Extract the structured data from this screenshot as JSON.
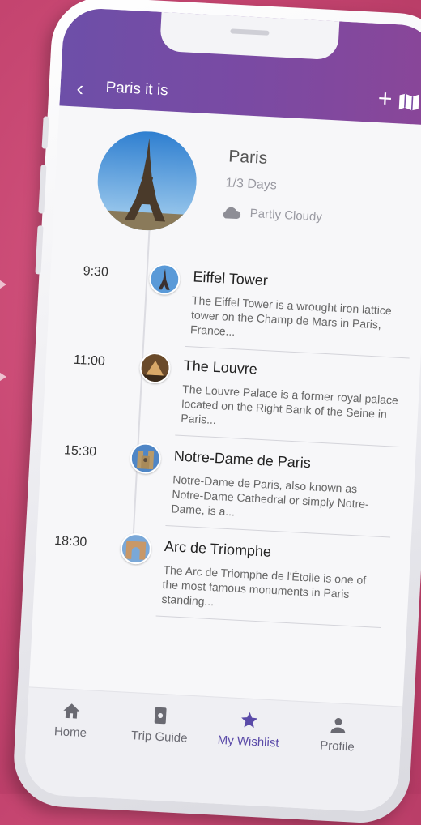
{
  "header": {
    "title": "Paris it is"
  },
  "city": {
    "name": "Paris",
    "days": "1/3 Days",
    "weather": "Partly Cloudy"
  },
  "stops": [
    {
      "time": "9:30",
      "name": "Eiffel Tower",
      "description": "The Eiffel Tower is a wrought iron lattice tower on the Champ de Mars in Paris, France..."
    },
    {
      "time": "11:00",
      "name": "The Louvre",
      "description": "The Louvre Palace is a former royal palace located on the Right Bank of the Seine in Paris..."
    },
    {
      "time": "15:30",
      "name": "Notre-Dame de Paris",
      "description": "Notre-Dame de Paris, also known as Notre-Dame Cathedral or simply Notre-Dame, is a..."
    },
    {
      "time": "18:30",
      "name": "Arc de Triomphe",
      "description": "The Arc de Triomphe de l'Étoile is one of the most famous monuments in Paris standing..."
    }
  ],
  "tabs": [
    {
      "label": "Home",
      "icon": "home-icon",
      "active": false
    },
    {
      "label": "Trip Guide",
      "icon": "guide-icon",
      "active": false
    },
    {
      "label": "My Wishlist",
      "icon": "star-icon",
      "active": true
    },
    {
      "label": "Profile",
      "icon": "profile-icon",
      "active": false
    }
  ],
  "colors": {
    "header_start": "#6d4fa8",
    "header_end": "#8a4698",
    "background": "#c4446f",
    "active_tab": "#5a4aa8"
  }
}
